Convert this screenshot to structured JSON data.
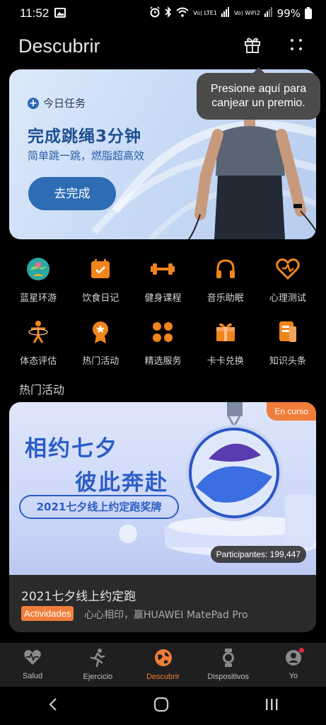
{
  "status_bar": {
    "time": "11:52",
    "battery": "99%",
    "sim1": "Vo) LTE1",
    "sim2": "Vo) WiFi2"
  },
  "header": {
    "title": "Descubrir",
    "gift_icon": "gift-icon",
    "menu_icon": "grid-dots-icon"
  },
  "tooltip": {
    "line1": "Presione aquí para",
    "line2": "canjear un premio."
  },
  "banner": {
    "tag": "今日任务",
    "title": "完成跳绳3分钟",
    "subtitle": "简单跳一跳，燃脂超高效",
    "button": "去完成"
  },
  "grid": [
    {
      "label": "蓝星环游",
      "icon": "globe-icon"
    },
    {
      "label": "饮食日记",
      "icon": "calendar-check-icon"
    },
    {
      "label": "健身课程",
      "icon": "dumbbell-icon"
    },
    {
      "label": "音乐助眠",
      "icon": "headphones-icon"
    },
    {
      "label": "心理测试",
      "icon": "heart-icon"
    },
    {
      "label": "体态评估",
      "icon": "posture-icon"
    },
    {
      "label": "热门活动",
      "icon": "medal-icon"
    },
    {
      "label": "精选服务",
      "icon": "clover-icon"
    },
    {
      "label": "卡卡兑换",
      "icon": "gift-box-icon"
    },
    {
      "label": "知识头条",
      "icon": "article-icon"
    }
  ],
  "section_title": "热门活动",
  "activity": {
    "poster_line1": "相约七夕",
    "poster_line2": "彼此奔赴",
    "poster_pill": "2021七夕线上约定跑奖牌",
    "status": "En curso",
    "participants": "Participantes: 199,447",
    "title": "2021七夕线上约定跑",
    "tag": "Actividades",
    "description": "心心相印，赢HUAWEI MatePad Pro"
  },
  "bottom_nav": [
    {
      "label": "Salud",
      "icon": "heart-pulse-icon",
      "active": false
    },
    {
      "label": "Ejercicio",
      "icon": "runner-icon",
      "active": false
    },
    {
      "label": "Descubrir",
      "icon": "compass-globe-icon",
      "active": true
    },
    {
      "label": "Dispositivos",
      "icon": "watch-icon",
      "active": false
    },
    {
      "label": "Yo",
      "icon": "profile-icon",
      "active": false
    }
  ],
  "colors": {
    "accent": "#f07d39",
    "banner_blue": "#2e6db4",
    "background": "#000000",
    "tooltip_bg": "#4b4b4b"
  }
}
